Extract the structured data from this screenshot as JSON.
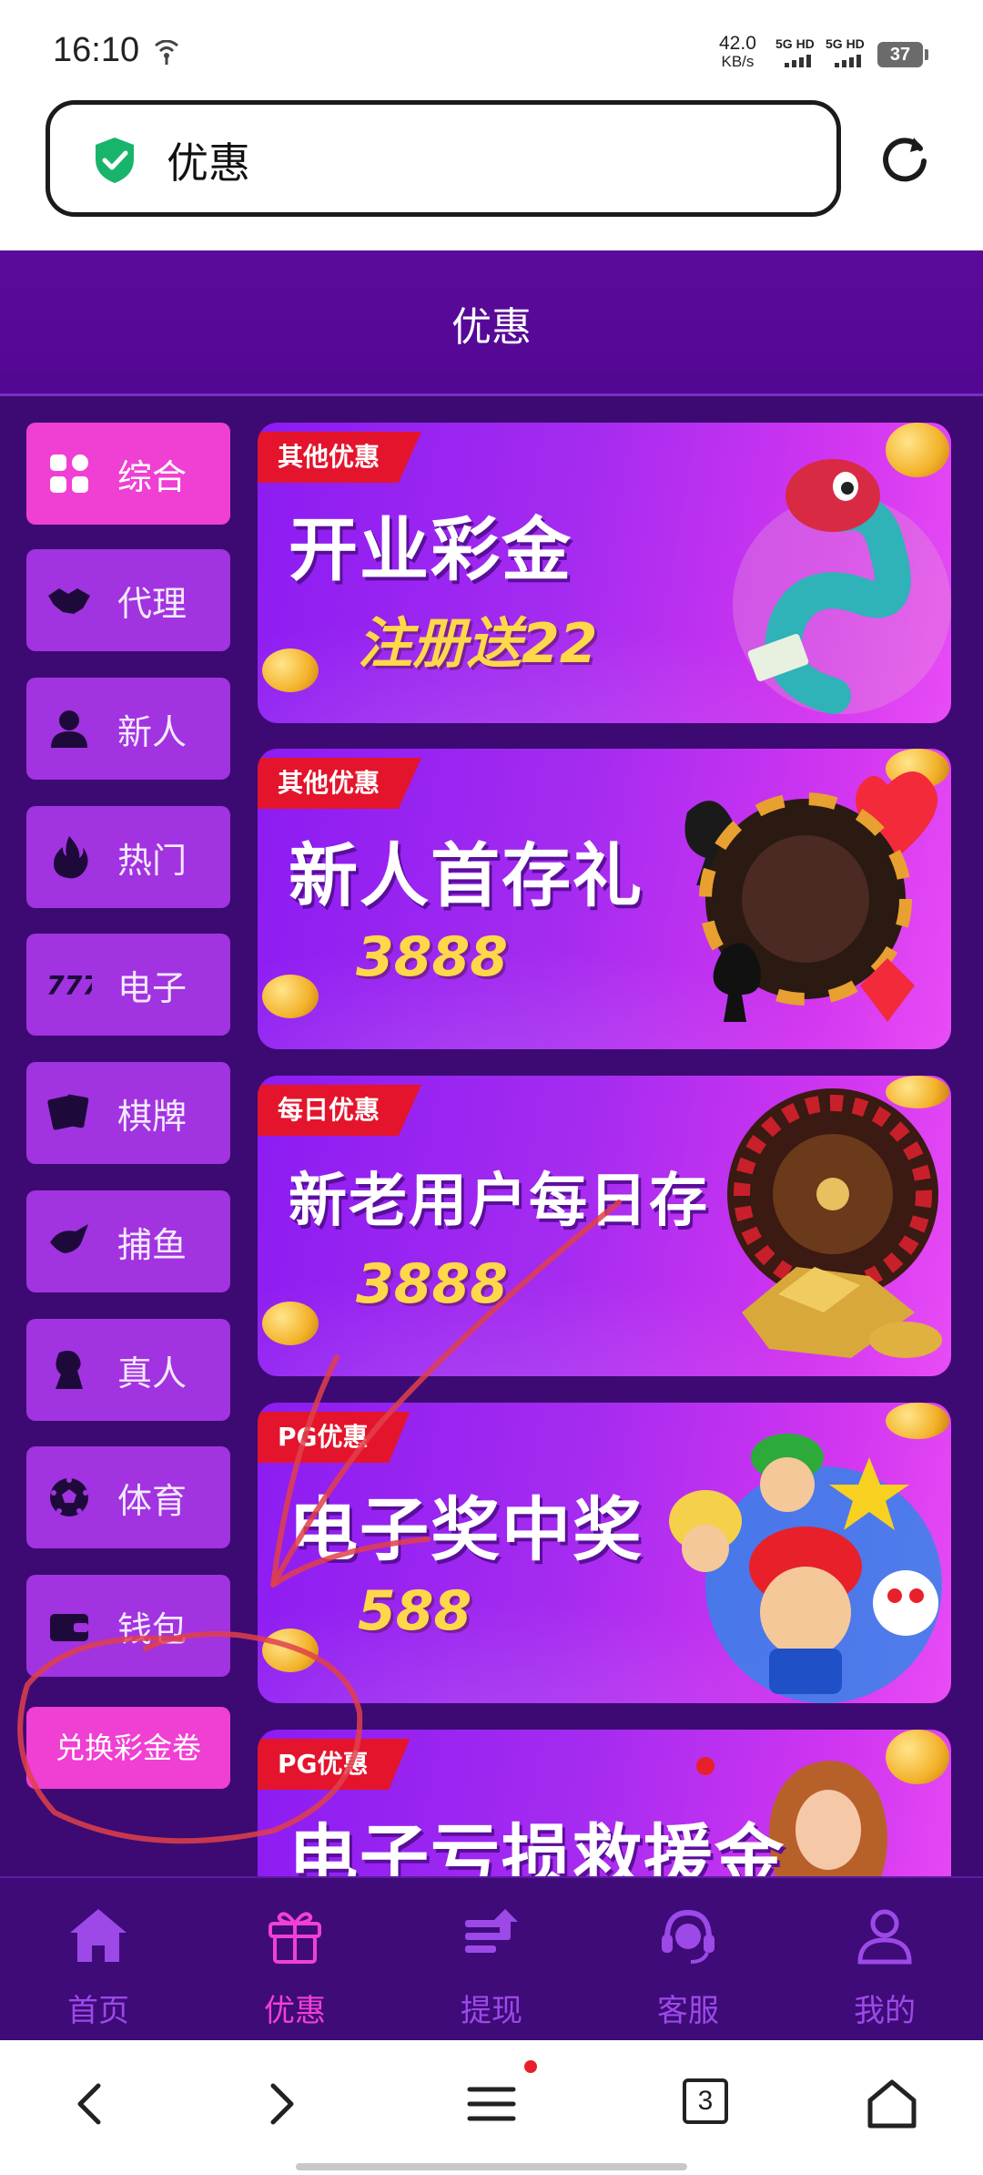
{
  "status_bar": {
    "time": "16:10",
    "speed_value": "42.0",
    "speed_unit": "KB/s",
    "net1": "5G HD",
    "net2": "5G HD",
    "battery": "37"
  },
  "address_bar": {
    "url_text": "优惠",
    "secure_icon": "shield-check-icon",
    "reload_icon": "reload-icon"
  },
  "header": {
    "title": "优惠"
  },
  "sidebar": {
    "items": [
      {
        "label": "综合",
        "icon": "grid-icon",
        "active": true
      },
      {
        "label": "代理",
        "icon": "handshake-icon"
      },
      {
        "label": "新人",
        "icon": "person-icon"
      },
      {
        "label": "热门",
        "icon": "fire-icon"
      },
      {
        "label": "电子",
        "icon": "slot-777-icon"
      },
      {
        "label": "棋牌",
        "icon": "cards-icon"
      },
      {
        "label": "捕鱼",
        "icon": "fish-icon"
      },
      {
        "label": "真人",
        "icon": "dealer-icon"
      },
      {
        "label": "体育",
        "icon": "soccer-ball-icon"
      },
      {
        "label": "钱包",
        "icon": "wallet-icon"
      }
    ],
    "redeem_label": "兑换彩金卷"
  },
  "banners": [
    {
      "tag": "其他优惠",
      "title": "开业彩金",
      "subtitle": "注册送22"
    },
    {
      "tag": "其他优惠",
      "title": "新人首存礼",
      "subtitle": "3888"
    },
    {
      "tag": "每日优惠",
      "title": "新老用户每日存",
      "subtitle": "3888"
    },
    {
      "tag": "PG优惠",
      "title": "电子奖中奖",
      "subtitle": "588"
    },
    {
      "tag": "PG优惠",
      "title": "电子亏损救援金",
      "subtitle": ""
    }
  ],
  "bottom_nav": {
    "items": [
      {
        "label": "首页",
        "icon": "home-icon"
      },
      {
        "label": "优惠",
        "icon": "gift-icon",
        "active": true
      },
      {
        "label": "提现",
        "icon": "withdraw-icon"
      },
      {
        "label": "客服",
        "icon": "headset-icon"
      },
      {
        "label": "我的",
        "icon": "user-icon"
      }
    ]
  },
  "browser_nav": {
    "tabs_count": "3"
  },
  "colors": {
    "header_bg": "#520893",
    "content_bg": "#3c0a72",
    "side_button": "#a233e0",
    "side_button_active": "#f03fd3",
    "banner_tag": "#e4142c",
    "annotation": "#e0404a"
  }
}
